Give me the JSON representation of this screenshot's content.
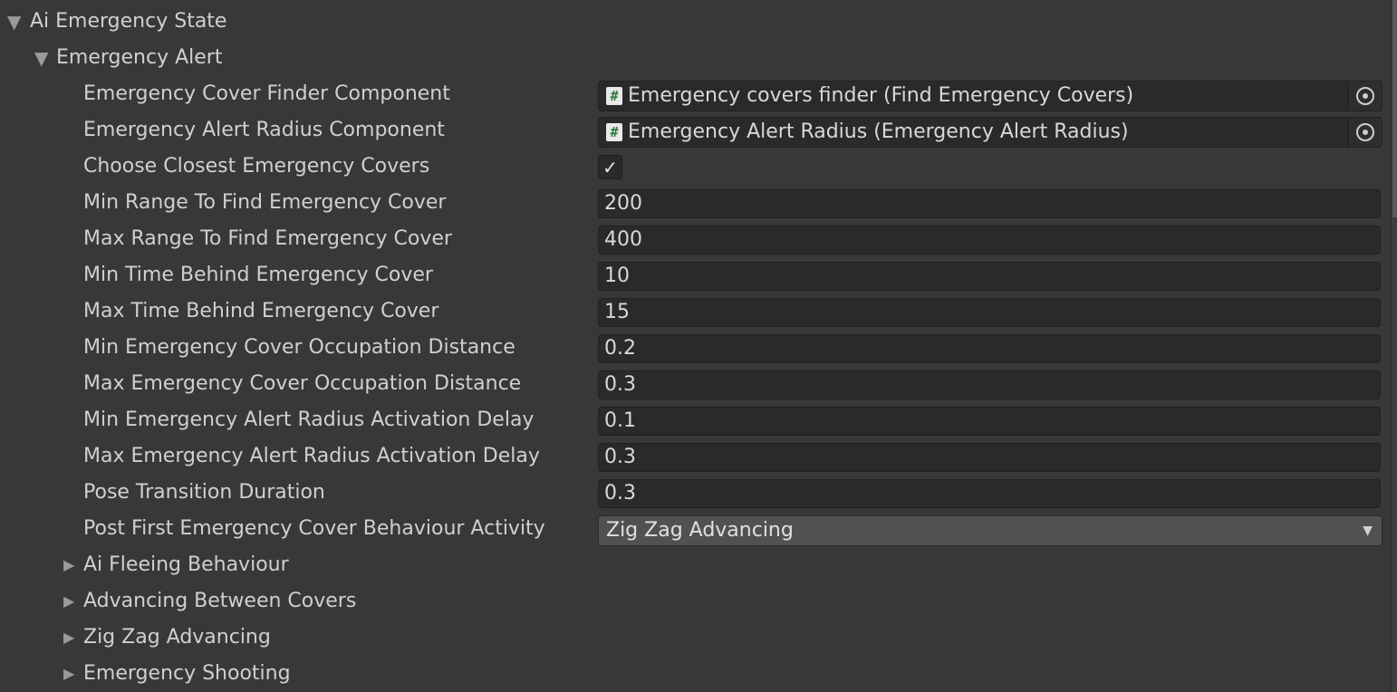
{
  "root": {
    "label": "Ai Emergency State",
    "expanded_icon": "triangle-down-icon"
  },
  "section": {
    "label": "Emergency Alert",
    "expanded_icon": "triangle-down-icon"
  },
  "fields": {
    "cover_finder": {
      "label": "Emergency Cover Finder Component",
      "value": "Emergency covers finder (Find Emergency Covers)",
      "icon": "#"
    },
    "alert_radius": {
      "label": "Emergency Alert Radius Component",
      "value": "Emergency Alert Radius  (Emergency Alert Radius)",
      "icon": "#"
    },
    "choose_closest": {
      "label": "Choose Closest Emergency Covers",
      "checked_glyph": "✓"
    },
    "min_range": {
      "label": "Min Range To Find Emergency Cover",
      "value": "200"
    },
    "max_range": {
      "label": "Max Range To Find Emergency Cover",
      "value": "400"
    },
    "min_time": {
      "label": "Min Time Behind Emergency Cover",
      "value": "10"
    },
    "max_time": {
      "label": "Max Time Behind Emergency Cover",
      "value": "15"
    },
    "min_occupation": {
      "label": "Min Emergency Cover Occupation Distance",
      "value": "0.2"
    },
    "max_occupation": {
      "label": "Max Emergency Cover Occupation Distance",
      "value": "0.3"
    },
    "min_activation": {
      "label": "Min Emergency Alert Radius Activation Delay",
      "value": "0.1"
    },
    "max_activation": {
      "label": "Max Emergency Alert Radius Activation Delay",
      "value": "0.3"
    },
    "pose_transition": {
      "label": "Pose Transition Duration",
      "value": "0.3"
    },
    "post_first": {
      "label": "Post First Emergency Cover Behaviour Activity",
      "value": "Zig Zag Advancing"
    }
  },
  "subsections": [
    {
      "label": "Ai Fleeing Behaviour"
    },
    {
      "label": "Advancing Between Covers"
    },
    {
      "label": "Zig Zag Advancing"
    },
    {
      "label": "Emergency Shooting"
    }
  ],
  "glyphs": {
    "expanded": "▼",
    "collapsed": "▶",
    "dropdown": "▼"
  },
  "colors": {
    "background": "#383838",
    "field_background": "#2a2a2a",
    "dropdown_background": "#515151",
    "text": "#d0d0d0",
    "script_icon_green": "#2f7a3a"
  }
}
